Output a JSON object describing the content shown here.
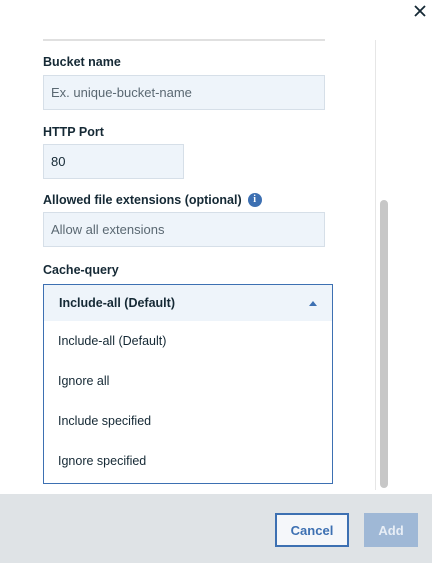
{
  "form": {
    "bucket_name": {
      "label": "Bucket name",
      "placeholder": "Ex. unique-bucket-name",
      "value": ""
    },
    "http_port": {
      "label": "HTTP Port",
      "value": "80"
    },
    "allowed_extensions": {
      "label": "Allowed file extensions (optional)",
      "placeholder": "Allow all extensions",
      "info_icon": "info-icon"
    },
    "cache_query": {
      "label": "Cache-query",
      "selected": "Include-all (Default)",
      "options": [
        "Include-all (Default)",
        "Ignore all",
        "Include specified",
        "Ignore specified"
      ]
    }
  },
  "footer": {
    "cancel_label": "Cancel",
    "add_label": "Add"
  },
  "colors": {
    "accent": "#3d70b2",
    "input_bg": "#eef4fa",
    "footer_bg": "#dfe3e6",
    "add_disabled": "#9fb8d6"
  }
}
